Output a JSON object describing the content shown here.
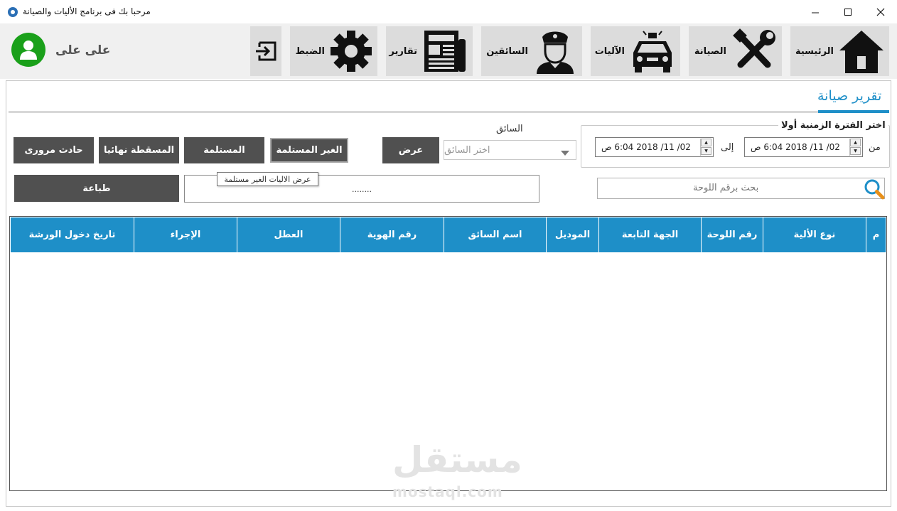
{
  "window": {
    "title": "مرحبا بك فى برنامج الأليات والصيانة",
    "icon": "app-gear-icon"
  },
  "header": {
    "user_name": "على على",
    "avatar_icon": "user-icon",
    "nav": [
      {
        "label": "الرئيسية",
        "icon": "home-icon"
      },
      {
        "label": "الصيانة",
        "icon": "tools-icon"
      },
      {
        "label": "الآليات",
        "icon": "taxi-icon"
      },
      {
        "label": "السائقين",
        "icon": "driver-icon"
      },
      {
        "label": "تقارير",
        "icon": "newspaper-icon"
      },
      {
        "label": "الضبط",
        "icon": "gear-icon"
      }
    ],
    "logout_icon": "logout-icon"
  },
  "page": {
    "title": "تقرير صيانة",
    "accent_color": "#1e8fc8"
  },
  "period": {
    "title": "اختر الفترة الزمنية أولا",
    "from_label": "من",
    "to_label": "إلى",
    "from_value": "02/ 11/ 2018  6:04 ص",
    "to_value": "02/ 11/ 2018  6:04 ص"
  },
  "driver": {
    "label": "السائق",
    "placeholder": "اختر السائق"
  },
  "buttons": {
    "show": "عرض",
    "not_received": "الغير المستلمة",
    "received": "المستلمة",
    "dropped": "المسقطة نهائيا",
    "accident": "حادث مرورى",
    "print": "طباعة"
  },
  "info": {
    "text": "........",
    "tooltip": "عرض الاليات الغير مستلمة"
  },
  "search": {
    "placeholder": "بحث برقم اللوحة"
  },
  "table": {
    "columns": [
      "م",
      "نوع الألية",
      "رقم اللوحة",
      "الجهة التابعة",
      "الموديل",
      "اسم السائق",
      "رقم الهوية",
      "العطل",
      "الإجراء",
      "تاريخ دخول الورشة"
    ],
    "rows": []
  },
  "watermark": {
    "main": "مستقل",
    "sub": "mostaql.com"
  }
}
